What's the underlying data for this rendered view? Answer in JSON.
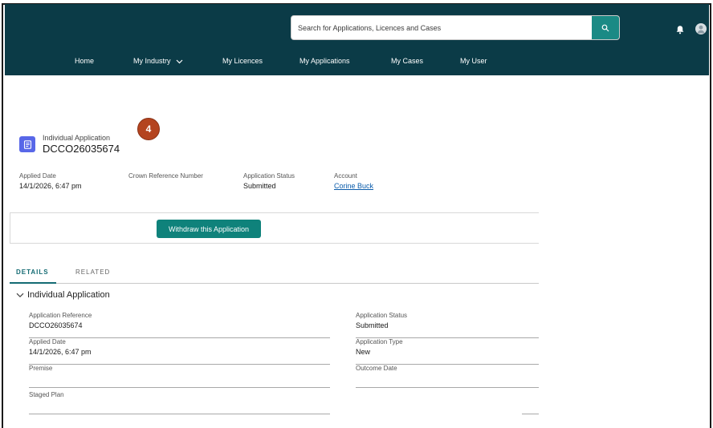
{
  "search": {
    "placeholder": "Search for Applications, Licences and Cases"
  },
  "nav": {
    "home": "Home",
    "my_industry": "My Industry",
    "my_licences": "My Licences",
    "my_applications": "My Applications",
    "my_cases": "My Cases",
    "my_user": "My User"
  },
  "step_badge": "4",
  "record": {
    "object_label": "Individual Application",
    "title": "DCCO26035674"
  },
  "highlights": {
    "applied_date_label": "Applied Date",
    "applied_date": "14/1/2026, 6:47 pm",
    "crown_ref_label": "Crown Reference Number",
    "status_label": "Application Status",
    "status": "Submitted",
    "account_label": "Account",
    "account": "Corine Buck"
  },
  "actions": {
    "withdraw": "Withdraw this Application"
  },
  "tabs": {
    "details": "DETAILS",
    "related": "RELATED"
  },
  "section": {
    "title": "Individual Application",
    "fields": {
      "app_ref_label": "Application Reference",
      "app_ref": "DCCO26035674",
      "applied_date_label": "Applied Date",
      "applied_date": "14/1/2026, 6:47 pm",
      "premise_label": "Premise",
      "staged_plan_label": "Staged Plan",
      "status_label": "Application Status",
      "status": "Submitted",
      "type_label": "Application Type",
      "type": "New",
      "outcome_label": "Outcome Date"
    }
  },
  "colors": {
    "header_bg": "#0b3b47",
    "accent_teal": "#0f827b",
    "record_icon": "#5867e8",
    "badge": "#b4441f",
    "link": "#0b5cab"
  }
}
